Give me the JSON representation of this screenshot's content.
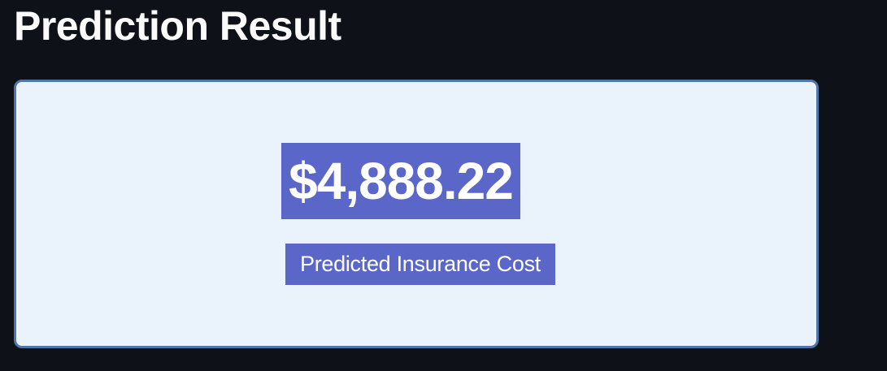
{
  "header": {
    "title": "Prediction Result"
  },
  "result": {
    "amount": "$4,888.22",
    "caption": "Predicted Insurance Cost"
  },
  "colors": {
    "background": "#0e1117",
    "card_background": "#eaf3fb",
    "card_border": "#4f76ab",
    "highlight": "#5b67c8"
  }
}
